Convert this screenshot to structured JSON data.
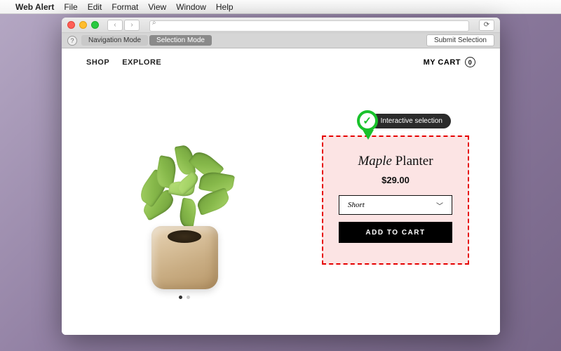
{
  "menubar": {
    "app_name": "Web Alert",
    "items": [
      "File",
      "Edit",
      "Format",
      "View",
      "Window",
      "Help"
    ]
  },
  "toolbar": {
    "search_placeholder": "",
    "mode_navigation": "Navigation Mode",
    "mode_selection": "Selection Mode",
    "submit": "Submit Selection"
  },
  "nav": {
    "shop": "SHOP",
    "explore": "EXPLORE",
    "cart_label": "MY CART",
    "cart_count": "0"
  },
  "product": {
    "name_italic": "Maple",
    "name_rest": " Planter",
    "price": "$29.00",
    "size_selected": "Short",
    "add_to_cart": "ADD TO CART"
  },
  "tooltip": {
    "label": "Interactive selection"
  }
}
